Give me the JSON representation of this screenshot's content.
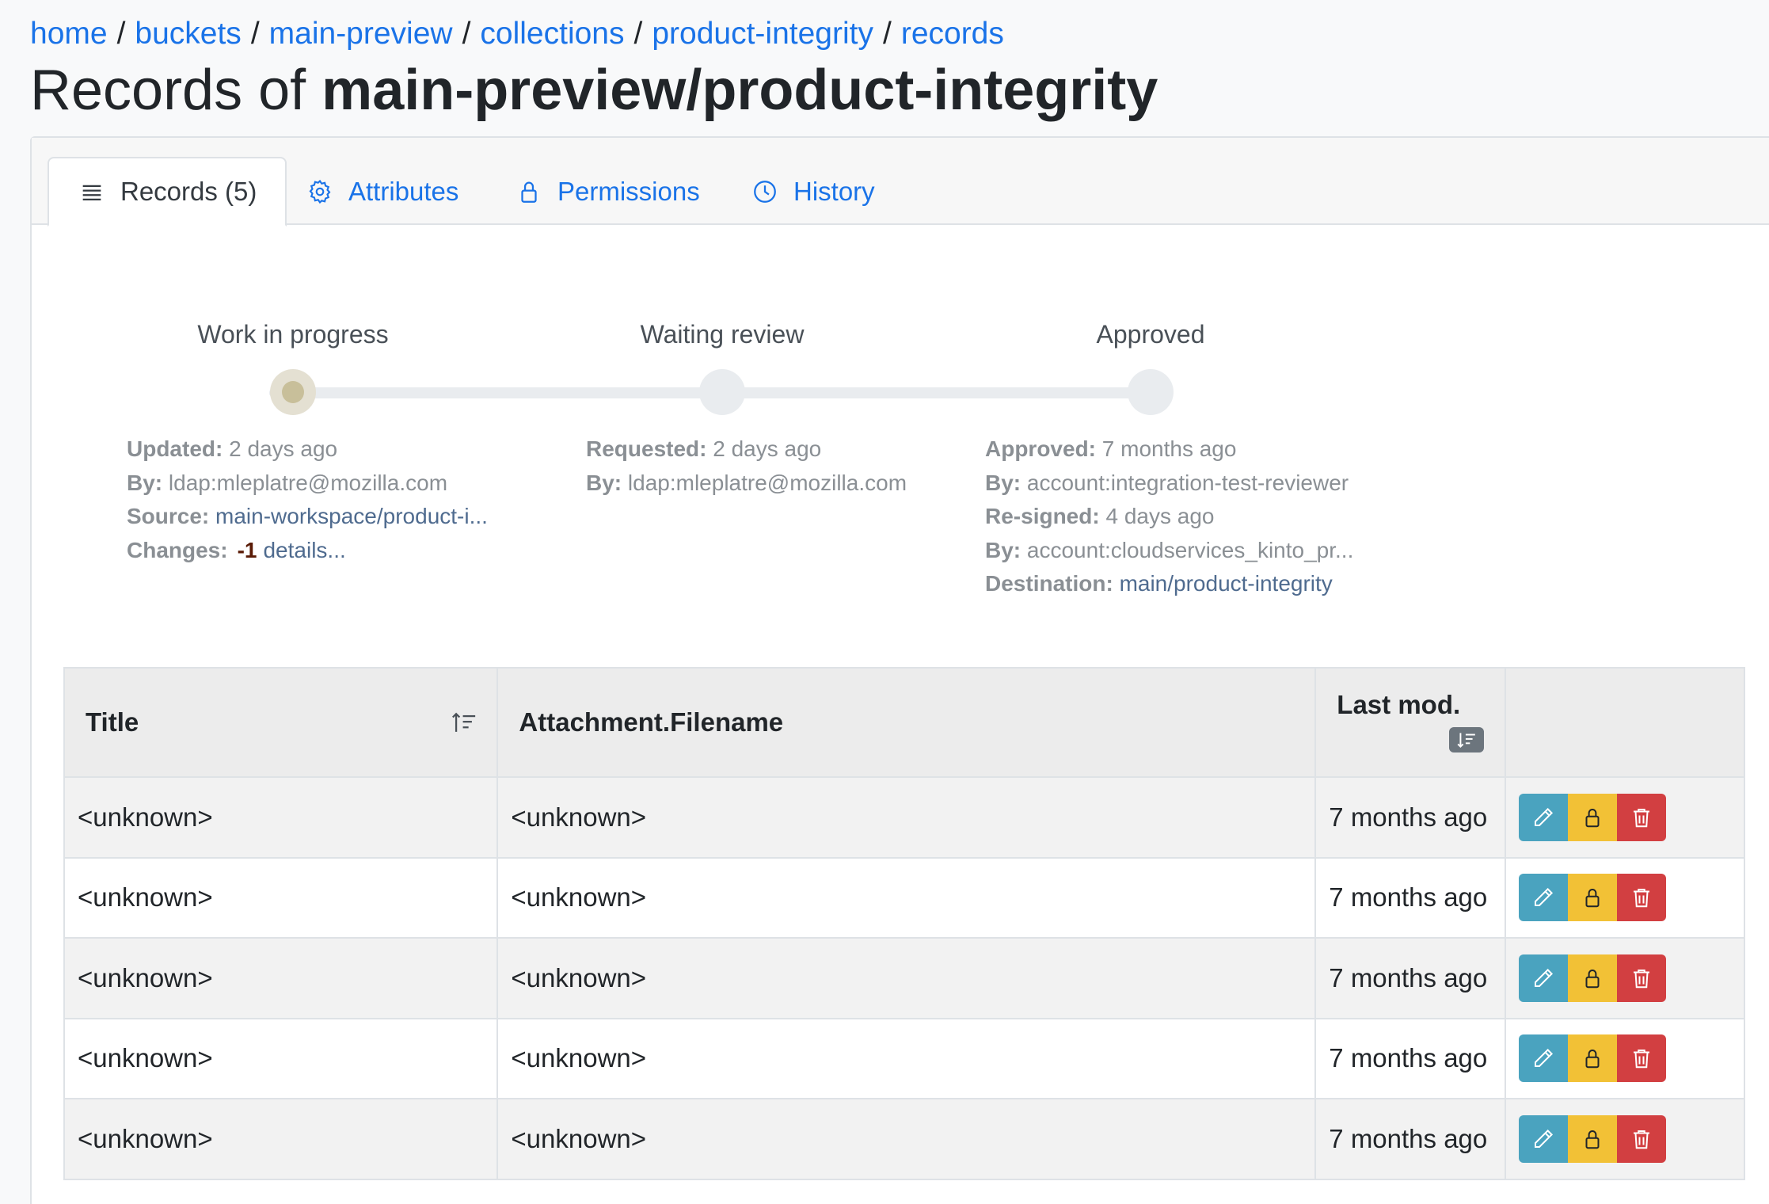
{
  "breadcrumb": [
    {
      "label": "home"
    },
    {
      "label": "buckets"
    },
    {
      "label": "main-preview"
    },
    {
      "label": "collections"
    },
    {
      "label": "product-integrity"
    },
    {
      "label": "records"
    }
  ],
  "page_title": {
    "prefix": "Records of",
    "name": "main-preview/product-integrity"
  },
  "tabs": [
    {
      "label": "Records (5)",
      "icon": "list-icon",
      "active": true
    },
    {
      "label": "Attributes",
      "icon": "gear-icon",
      "active": false
    },
    {
      "label": "Permissions",
      "icon": "lock-icon",
      "active": false
    },
    {
      "label": "History",
      "icon": "clock-icon",
      "active": false
    }
  ],
  "workflow": {
    "steps": [
      {
        "label": "Work in progress",
        "current": true
      },
      {
        "label": "Waiting review",
        "current": false
      },
      {
        "label": "Approved",
        "current": false
      }
    ],
    "work_in_progress": {
      "updated_key": "Updated:",
      "updated_val": "2 days ago",
      "by_key": "By:",
      "by_val": "ldap:mleplatre@mozilla.com",
      "source_key": "Source:",
      "source_val": "main-workspace/product-i...",
      "changes_key": "Changes:",
      "changes_val": "-1",
      "changes_link": "details..."
    },
    "waiting_review": {
      "requested_key": "Requested:",
      "requested_val": "2 days ago",
      "by_key": "By:",
      "by_val": "ldap:mleplatre@mozilla.com"
    },
    "approved": {
      "approved_key": "Approved:",
      "approved_val": "7 months ago",
      "by_key": "By:",
      "by_val": "account:integration-test-reviewer",
      "resigned_key": "Re-signed:",
      "resigned_val": "4 days ago",
      "by2_key": "By:",
      "by2_val": "account:cloudservices_kinto_pr...",
      "destination_key": "Destination:",
      "destination_val": "main/product-integrity"
    }
  },
  "table": {
    "columns": [
      "Title",
      "Attachment.Filename",
      "Last mod."
    ],
    "rows": [
      {
        "title": "<unknown>",
        "filename": "<unknown>",
        "last_mod": "7 months ago"
      },
      {
        "title": "<unknown>",
        "filename": "<unknown>",
        "last_mod": "7 months ago"
      },
      {
        "title": "<unknown>",
        "filename": "<unknown>",
        "last_mod": "7 months ago"
      },
      {
        "title": "<unknown>",
        "filename": "<unknown>",
        "last_mod": "7 months ago"
      },
      {
        "title": "<unknown>",
        "filename": "<unknown>",
        "last_mod": "7 months ago"
      }
    ],
    "actions": [
      {
        "icon": "pencil-icon",
        "color": "#4aa3bf"
      },
      {
        "icon": "lock-icon",
        "color": "#f2c136"
      },
      {
        "icon": "trash-icon",
        "color": "#d23f41"
      }
    ]
  },
  "colors": {
    "link": "#1a73e8",
    "edit": "#4aa3bf",
    "permissions": "#f2c136",
    "delete": "#d23f41"
  }
}
